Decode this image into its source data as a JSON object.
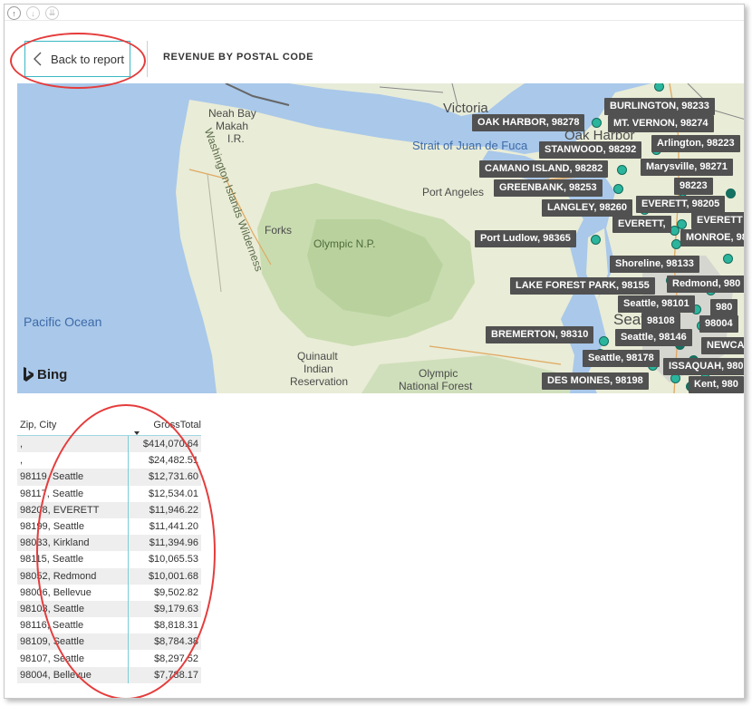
{
  "toolbar": {
    "icons": [
      "arrow-up-icon",
      "arrow-down-icon",
      "double-arrow-down-icon"
    ]
  },
  "header": {
    "back_label": "Back to report",
    "page_title": "REVENUE BY POSTAL CODE"
  },
  "map": {
    "provider": "Bing",
    "place_labels": {
      "neah_bay": "Neah Bay",
      "makah": "Makah",
      "ir": "I.R.",
      "victoria": "Victoria",
      "strait": "Strait of Juan de Fuca",
      "oak_harbor": "Oak Harbor",
      "port_angeles": "Port Angeles",
      "wilderness": "Washington Islands Wilderness",
      "forks": "Forks",
      "olympic_np": "Olympic N.P.",
      "pacific_ocean": "Pacific Ocean",
      "quinault": "Quinault",
      "indian": "Indian",
      "reservation": "Reservation",
      "olympic": "Olympic",
      "national_forest": "National Forest",
      "seattle": "Seattle"
    },
    "pins": {
      "burlington": "BURLINGTON, 98233",
      "oak_harbor": "OAK HARBOR, 98278",
      "mt_vernon": "MT. VERNON, 98274",
      "arlington": "Arlington, 98223",
      "stanwood": "STANWOOD, 98292",
      "marysville": "Marysville, 98271",
      "camano": "CAMANO ISLAND, 98282",
      "greenbank": "GREENBANK, 98253",
      "p98223": "98223",
      "langley": "LANGLEY, 98260",
      "everett1": "EVERETT, 98205",
      "everett2": "EVERETT,",
      "everett3": "EVERETT",
      "monroe": "MONROE, 98",
      "port_ludlow": "Port Ludlow, 98365",
      "shoreline": "Shoreline, 98133",
      "lake_forest": "LAKE FOREST PARK, 98155",
      "redmond": "Redmond, 980",
      "seattle101": "Seattle, 98101",
      "p980": "980",
      "p98108": "98108",
      "p98004": "98004",
      "bremerton": "BREMERTON, 98310",
      "seattle146": "Seattle, 98146",
      "newca": "NEWCA",
      "seattle178": "Seattle, 98178",
      "issaquah": "ISSAQUAH, 980",
      "des_moines": "DES MOINES, 98198",
      "kent": "Kent, 980"
    }
  },
  "table": {
    "columns": [
      "Zip, City",
      "GrossTotal"
    ],
    "rows": [
      [
        ",",
        "$414,070.64"
      ],
      [
        ",",
        "$24,482.51"
      ],
      [
        "98119, Seattle",
        "$12,731.60"
      ],
      [
        "98117, Seattle",
        "$12,534.01"
      ],
      [
        "98208, EVERETT",
        "$11,946.22"
      ],
      [
        "98199, Seattle",
        "$11,441.20"
      ],
      [
        "98033, Kirkland",
        "$11,394.96"
      ],
      [
        "98115, Seattle",
        "$10,065.53"
      ],
      [
        "98052, Redmond",
        "$10,001.68"
      ],
      [
        "98006, Bellevue",
        "$9,502.82"
      ],
      [
        "98103, Seattle",
        "$9,179.63"
      ],
      [
        "98116, Seattle",
        "$8,818.31"
      ],
      [
        "98109, Seattle",
        "$8,784.38"
      ],
      [
        "98107, Seattle",
        "$8,297.52"
      ],
      [
        "98004, Bellevue",
        "$7,788.17"
      ]
    ]
  },
  "colors": {
    "annotation": "#e53c3c",
    "focus_border": "#3bb8c4",
    "pin_fill": "#2bb59c",
    "label_bg": "#515151"
  }
}
